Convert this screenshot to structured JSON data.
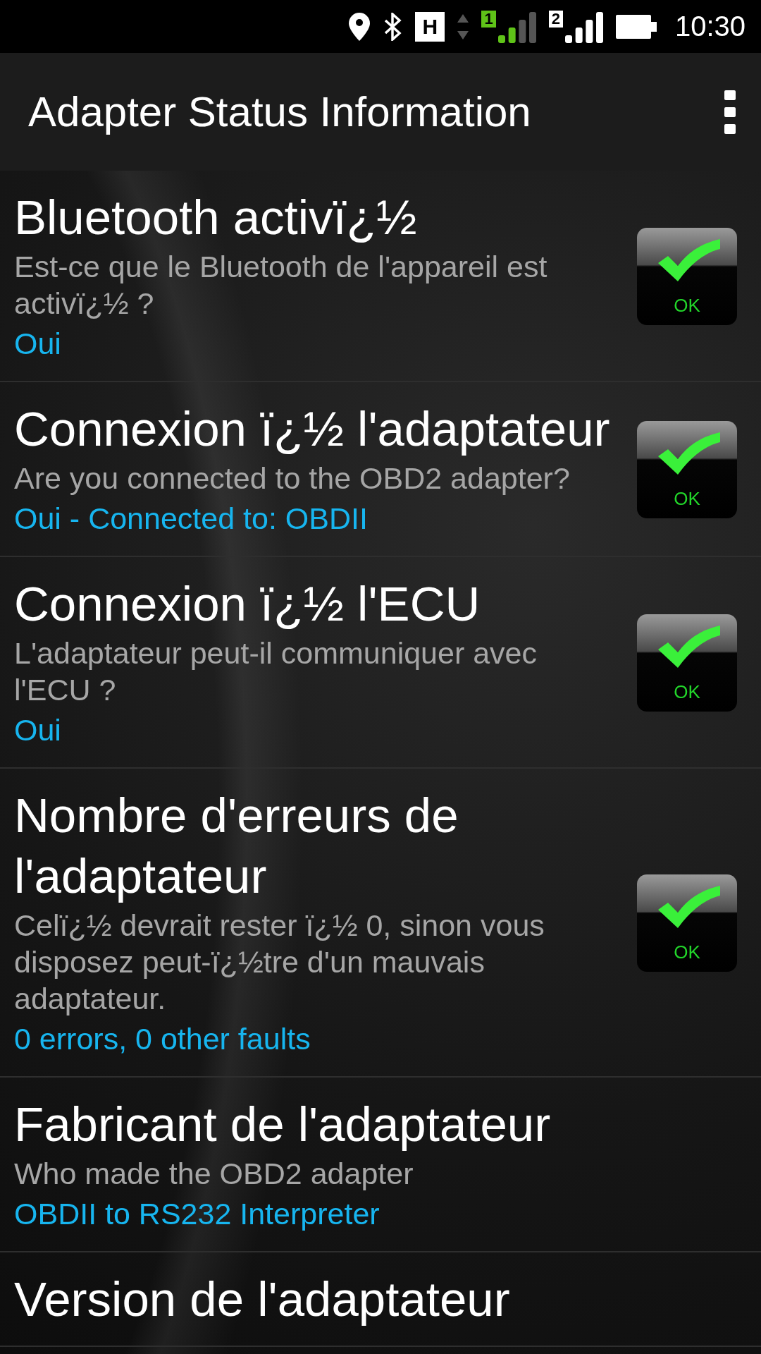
{
  "status_bar": {
    "network_type": "H",
    "sims": [
      {
        "label": "1"
      },
      {
        "label": "2"
      }
    ],
    "time": "10:30"
  },
  "app_bar": {
    "title": "Adapter Status Information"
  },
  "items": [
    {
      "title": "Bluetooth activï¿½",
      "description": "Est-ce que le Bluetooth de l'appareil est activï¿½ ?",
      "value": "Oui",
      "badge": {
        "kind": "ok",
        "label": "OK"
      }
    },
    {
      "title": "Connexion ï¿½ l'adaptateur",
      "description": "Are you connected to the OBD2 adapter?",
      "value": "Oui - Connected to: OBDII",
      "badge": {
        "kind": "ok",
        "label": "OK"
      }
    },
    {
      "title": "Connexion ï¿½ l'ECU",
      "description": "L'adaptateur peut-il communiquer avec l'ECU ?",
      "value": "Oui",
      "badge": {
        "kind": "ok",
        "label": "OK"
      }
    },
    {
      "title": "Nombre d'erreurs de l'adaptateur",
      "description": "Celï¿½ devrait rester ï¿½ 0, sinon vous disposez peut-ï¿½tre d'un mauvais adaptateur.",
      "value": "0 errors, 0 other faults",
      "badge": {
        "kind": "ok",
        "label": "OK"
      }
    },
    {
      "title": "Fabricant de l'adaptateur",
      "description": "Who made the OBD2 adapter",
      "value": "OBDII to RS232 Interpreter"
    },
    {
      "title": "Version de l'adaptateur"
    }
  ]
}
